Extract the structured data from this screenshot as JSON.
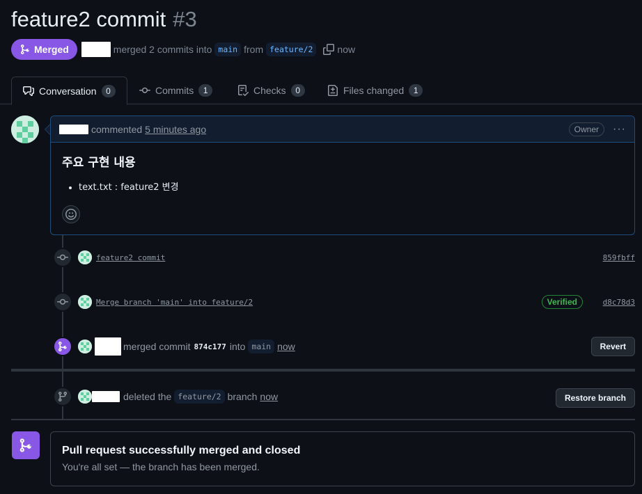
{
  "pr": {
    "title": "feature2 commit",
    "number": "#3",
    "state_label": "Merged",
    "merged_text": "merged 2 commits into",
    "base_branch": "main",
    "from_text": "from",
    "head_branch": "feature/2",
    "time": "now"
  },
  "tabs": [
    {
      "label": "Conversation",
      "count": "0",
      "icon": "comment-discussion-icon"
    },
    {
      "label": "Commits",
      "count": "1",
      "icon": "git-commit-icon"
    },
    {
      "label": "Checks",
      "count": "0",
      "icon": "checklist-icon"
    },
    {
      "label": "Files changed",
      "count": "1",
      "icon": "file-diff-icon"
    }
  ],
  "comment": {
    "action": "commented",
    "time": "5 minutes ago",
    "role_badge": "Owner",
    "heading": "주요 구현 내용",
    "bullets": [
      "text.txt : feature2 변경"
    ]
  },
  "timeline": {
    "commits": [
      {
        "message": "feature2 commit",
        "sha": "859fbff"
      },
      {
        "message": "Merge branch 'main' into feature/2",
        "sha": "d8c78d3",
        "verified": "Verified"
      }
    ],
    "merged_event": {
      "text": "merged commit",
      "sha": "874c177",
      "into": "into",
      "branch": "main",
      "time": "now",
      "button": "Revert"
    },
    "deleted_event": {
      "text": "deleted the",
      "branch": "feature/2",
      "suffix": "branch",
      "time": "now",
      "button": "Restore branch"
    }
  },
  "merge_status": {
    "title": "Pull request successfully merged and closed",
    "subtitle": "You're all set — the branch has been merged."
  },
  "colors": {
    "background": "#0d1117",
    "merged_purple": "#8957e5",
    "link_blue": "#6cb6ff",
    "verified_green": "#3fb950"
  }
}
